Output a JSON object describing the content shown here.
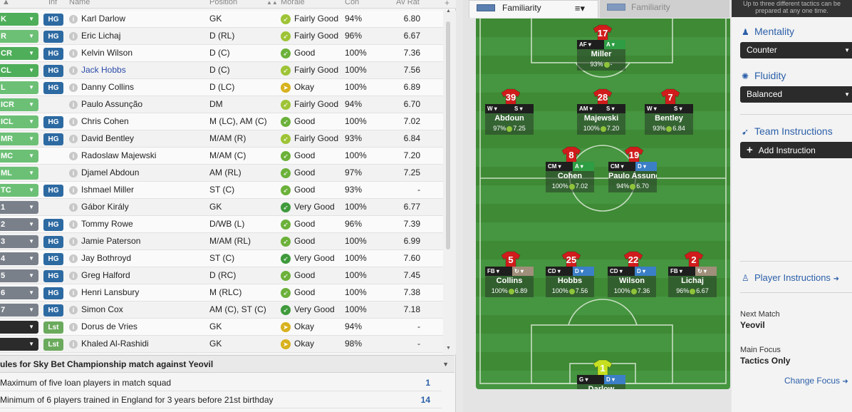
{
  "header": {
    "inf": "Inf",
    "name": "Name",
    "position": "Position",
    "morale": "Morale",
    "con": "Con",
    "av_rat": "Av Rat",
    "sort_arrows": "▲▲"
  },
  "players": [
    {
      "pos": "K",
      "posclass": "pg",
      "tag": "HG",
      "name": "Karl Darlow",
      "position": "GK",
      "morale": "Fairly Good",
      "mclass": "m-fg",
      "micon": "➶",
      "con": "94%",
      "rat": "6.80"
    },
    {
      "pos": "R",
      "posclass": "pl",
      "tag": "HG",
      "name": "Eric Lichaj",
      "position": "D (RL)",
      "morale": "Fairly Good",
      "mclass": "m-fg",
      "micon": "➶",
      "con": "96%",
      "rat": "6.67"
    },
    {
      "pos": "CR",
      "posclass": "pg",
      "tag": "HG",
      "name": "Kelvin Wilson",
      "position": "D (C)",
      "morale": "Good",
      "mclass": "m-g",
      "micon": "➶",
      "con": "100%",
      "rat": "7.36"
    },
    {
      "pos": "CL",
      "posclass": "pg",
      "tag": "HG",
      "name": "Jack Hobbs",
      "position": "D (C)",
      "morale": "Fairly Good",
      "mclass": "m-fg",
      "micon": "➶",
      "con": "100%",
      "rat": "7.56",
      "link": true
    },
    {
      "pos": "L",
      "posclass": "pl",
      "tag": "HG",
      "name": "Danny Collins",
      "position": "D (LC)",
      "morale": "Okay",
      "mclass": "m-ok",
      "micon": "➤",
      "con": "100%",
      "rat": "6.89"
    },
    {
      "pos": "ICR",
      "posclass": "pl",
      "tag": "",
      "name": "Paulo Assunção",
      "position": "DM",
      "morale": "Fairly Good",
      "mclass": "m-fg",
      "micon": "➶",
      "con": "94%",
      "rat": "6.70"
    },
    {
      "pos": "ICL",
      "posclass": "pl",
      "tag": "HG",
      "name": "Chris Cohen",
      "position": "M (LC), AM (C)",
      "morale": "Good",
      "mclass": "m-g",
      "micon": "➶",
      "con": "100%",
      "rat": "7.02"
    },
    {
      "pos": "MR",
      "posclass": "pl",
      "tag": "HG",
      "name": "David Bentley",
      "position": "M/AM (R)",
      "morale": "Fairly Good",
      "mclass": "m-fg",
      "micon": "➶",
      "con": "93%",
      "rat": "6.84"
    },
    {
      "pos": "MC",
      "posclass": "pl",
      "tag": "",
      "name": "Radoslaw Majewski",
      "position": "M/AM (C)",
      "morale": "Good",
      "mclass": "m-g",
      "micon": "➶",
      "con": "100%",
      "rat": "7.20"
    },
    {
      "pos": "ML",
      "posclass": "pl",
      "tag": "",
      "name": "Djamel Abdoun",
      "position": "AM (RL)",
      "morale": "Good",
      "mclass": "m-g",
      "micon": "➶",
      "con": "97%",
      "rat": "7.25"
    },
    {
      "pos": "TC",
      "posclass": "pl",
      "tag": "HG",
      "name": "Ishmael Miller",
      "position": "ST (C)",
      "morale": "Good",
      "mclass": "m-g",
      "micon": "➶",
      "con": "93%",
      "rat": "-"
    },
    {
      "pos": "1",
      "posclass": "pgr",
      "tag": "",
      "name": "Gábor Király",
      "position": "GK",
      "morale": "Very Good",
      "mclass": "m-vg",
      "micon": "➶",
      "con": "100%",
      "rat": "6.77"
    },
    {
      "pos": "2",
      "posclass": "pgr",
      "tag": "HG",
      "name": "Tommy Rowe",
      "position": "D/WB (L)",
      "morale": "Good",
      "mclass": "m-g",
      "micon": "➶",
      "con": "96%",
      "rat": "7.39"
    },
    {
      "pos": "3",
      "posclass": "pgr",
      "tag": "HG",
      "name": "Jamie Paterson",
      "position": "M/AM (RL)",
      "morale": "Good",
      "mclass": "m-g",
      "micon": "➶",
      "con": "100%",
      "rat": "6.99"
    },
    {
      "pos": "4",
      "posclass": "pgr",
      "tag": "HG",
      "name": "Jay Bothroyd",
      "position": "ST (C)",
      "morale": "Very Good",
      "mclass": "m-vg",
      "micon": "➶",
      "con": "100%",
      "rat": "7.60"
    },
    {
      "pos": "5",
      "posclass": "pgr",
      "tag": "HG",
      "name": "Greg Halford",
      "position": "D (RC)",
      "morale": "Good",
      "mclass": "m-g",
      "micon": "➶",
      "con": "100%",
      "rat": "7.45"
    },
    {
      "pos": "6",
      "posclass": "pgr",
      "tag": "HG",
      "name": "Henri Lansbury",
      "position": "M (RLC)",
      "morale": "Good",
      "mclass": "m-g",
      "micon": "➶",
      "con": "100%",
      "rat": "7.38"
    },
    {
      "pos": "7",
      "posclass": "pgr",
      "tag": "HG",
      "name": "Simon Cox",
      "position": "AM (C), ST (C)",
      "morale": "Very Good",
      "mclass": "m-vg",
      "micon": "➶",
      "con": "100%",
      "rat": "7.18"
    },
    {
      "pos": "",
      "posclass": "pd",
      "tag": "Lst",
      "name": "Dorus de Vries",
      "position": "GK",
      "morale": "Okay",
      "mclass": "m-ok",
      "micon": "➤",
      "con": "94%",
      "rat": "-"
    },
    {
      "pos": "",
      "posclass": "pd",
      "tag": "Lst",
      "name": "Khaled Al-Rashidi",
      "position": "GK",
      "morale": "Okay",
      "mclass": "m-ok",
      "micon": "➤",
      "con": "98%",
      "rat": "-"
    }
  ],
  "rules": {
    "title": "ules for Sky Bet Championship match against Yeovil",
    "items": [
      {
        "text": "Maximum of five loan players in match squad",
        "value": "1"
      },
      {
        "text": "Minimum of 6 players trained in England for 3 years before 21st birthday",
        "value": "14"
      }
    ]
  },
  "tabs": {
    "tab1": "Familiarity",
    "tab2": "Familiarity",
    "menu": "≡▾"
  },
  "pitch_players": [
    {
      "num": "17",
      "role": "AF",
      "duty": "A",
      "dclass": "d-a",
      "name": "Miller",
      "cond": "93%",
      "rat": "-"
    },
    {
      "num": "39",
      "role": "W",
      "duty": "S",
      "dclass": "d-s",
      "name": "Abdoun",
      "cond": "97%",
      "rat": "7.25"
    },
    {
      "num": "28",
      "role": "AM",
      "duty": "S",
      "dclass": "d-s",
      "name": "Majewski",
      "cond": "100%",
      "rat": "7.20"
    },
    {
      "num": "7",
      "role": "W",
      "duty": "S",
      "dclass": "d-s",
      "name": "Bentley",
      "cond": "93%",
      "rat": "6.84"
    },
    {
      "num": "8",
      "role": "CM",
      "duty": "A",
      "dclass": "d-a",
      "name": "Cohen",
      "cond": "100%",
      "rat": "7.02"
    },
    {
      "num": "19",
      "role": "CM",
      "duty": "D",
      "dclass": "d-d",
      "name": "Paulo Assunç...",
      "cond": "94%",
      "rat": "6.70"
    },
    {
      "num": "5",
      "role": "FB",
      "duty": "↻",
      "dclass": "d-su",
      "name": "Collins",
      "cond": "100%",
      "rat": "6.89"
    },
    {
      "num": "25",
      "role": "CD",
      "duty": "D",
      "dclass": "d-d",
      "name": "Hobbs",
      "cond": "100%",
      "rat": "7.56"
    },
    {
      "num": "22",
      "role": "CD",
      "duty": "D",
      "dclass": "d-d",
      "name": "Wilson",
      "cond": "100%",
      "rat": "7.36"
    },
    {
      "num": "2",
      "role": "FB",
      "duty": "↻",
      "dclass": "d-su",
      "name": "Lichaj",
      "cond": "96%",
      "rat": "6.67"
    },
    {
      "num": "1",
      "role": "G",
      "duty": "D",
      "dclass": "d-d",
      "name": "Darlow",
      "cond": "94%",
      "rat": "6.80",
      "gk": true
    }
  ],
  "right": {
    "note": "Up to three different tactics can be prepared at any one time.",
    "mentality_label": "Mentality",
    "mentality_value": "Counter",
    "fluidity_label": "Fluidity",
    "fluidity_value": "Balanced",
    "team_instr_label": "Team Instructions",
    "add_instr": "Add Instruction",
    "player_instr": "Player Instructions",
    "next_match_label": "Next Match",
    "next_match_value": "Yeovil",
    "main_focus_label": "Main Focus",
    "main_focus_value": "Tactics Only",
    "change_focus": "Change Focus"
  },
  "colors": {
    "accent": "#2b5fa8",
    "shirt": "#d11c1c",
    "gk_shirt": "#c6e021",
    "pitch": "#469540"
  }
}
